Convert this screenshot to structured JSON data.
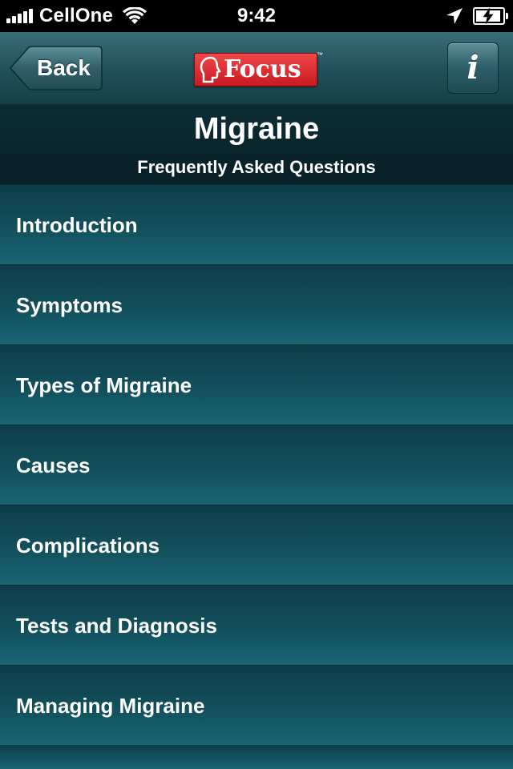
{
  "status_bar": {
    "carrier": "CellOne",
    "time": "9:42"
  },
  "nav": {
    "back_label": "Back",
    "logo_text": "Focus",
    "logo_tm": "™",
    "info_label": "i"
  },
  "header": {
    "title": "Migraine",
    "subtitle": "Frequently Asked Questions"
  },
  "faq_items": [
    "Introduction",
    "Symptoms",
    "Types of Migraine",
    "Causes",
    "Complications",
    "Tests and Diagnosis",
    "Managing Migraine"
  ],
  "colors": {
    "nav_bar": "#22525c",
    "header_bg": "#081f26",
    "list_bg": "#12505c",
    "logo_red": "#d7252b"
  }
}
